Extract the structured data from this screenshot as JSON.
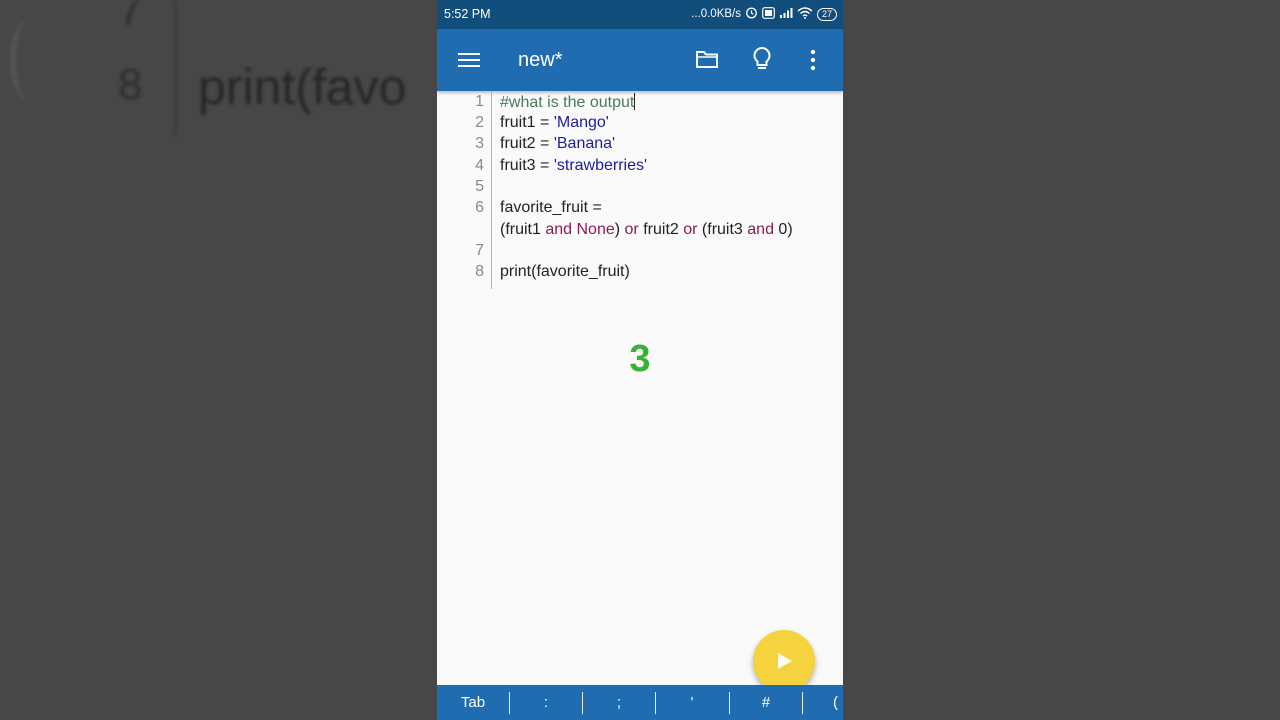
{
  "background_echo": {
    "line_numbers": [
      "7",
      "8"
    ],
    "code_fragment": "print(favo"
  },
  "status_bar": {
    "time": "5:52 PM",
    "network_speed": "...0.0KB/s",
    "battery": "27"
  },
  "app_bar": {
    "title": "new*",
    "icons": [
      "menu-icon",
      "folder-icon",
      "lightbulb-icon",
      "more-vert-icon"
    ]
  },
  "editor": {
    "line_numbers": [
      "1",
      "2",
      "3",
      "4",
      "5",
      "6",
      "7",
      "8"
    ],
    "lines": [
      {
        "comment": "#what is the output"
      },
      {
        "prefix": "fruit1 = ",
        "string": "'Mango'"
      },
      {
        "prefix": "fruit2 = ",
        "string": "'Banana'"
      },
      {
        "prefix": "fruit3 = ",
        "string": "'strawberries'"
      },
      {
        "text": ""
      },
      {
        "text": "favorite_fruit ="
      },
      {
        "p1": "(fruit1 ",
        "k1": "and",
        "p2": " ",
        "k2": "None",
        "p3": ") ",
        "k3": "or",
        "p4": " fruit2 ",
        "k4": "or",
        "p5": " (fruit3 ",
        "k5": "and",
        "p6": " 0)"
      },
      {
        "text": ""
      },
      {
        "text": "print(favorite_fruit)"
      }
    ]
  },
  "overlay_number": "3",
  "run_button": {
    "icon": "play-icon"
  },
  "key_bar": {
    "keys": [
      "Tab",
      ":",
      ";",
      "'",
      "#",
      "("
    ]
  },
  "colors": {
    "status_bar": "#124e7b",
    "app_bar": "#1f6db0",
    "overlay_number": "#3cb035",
    "run_button": "#f5d33f"
  }
}
